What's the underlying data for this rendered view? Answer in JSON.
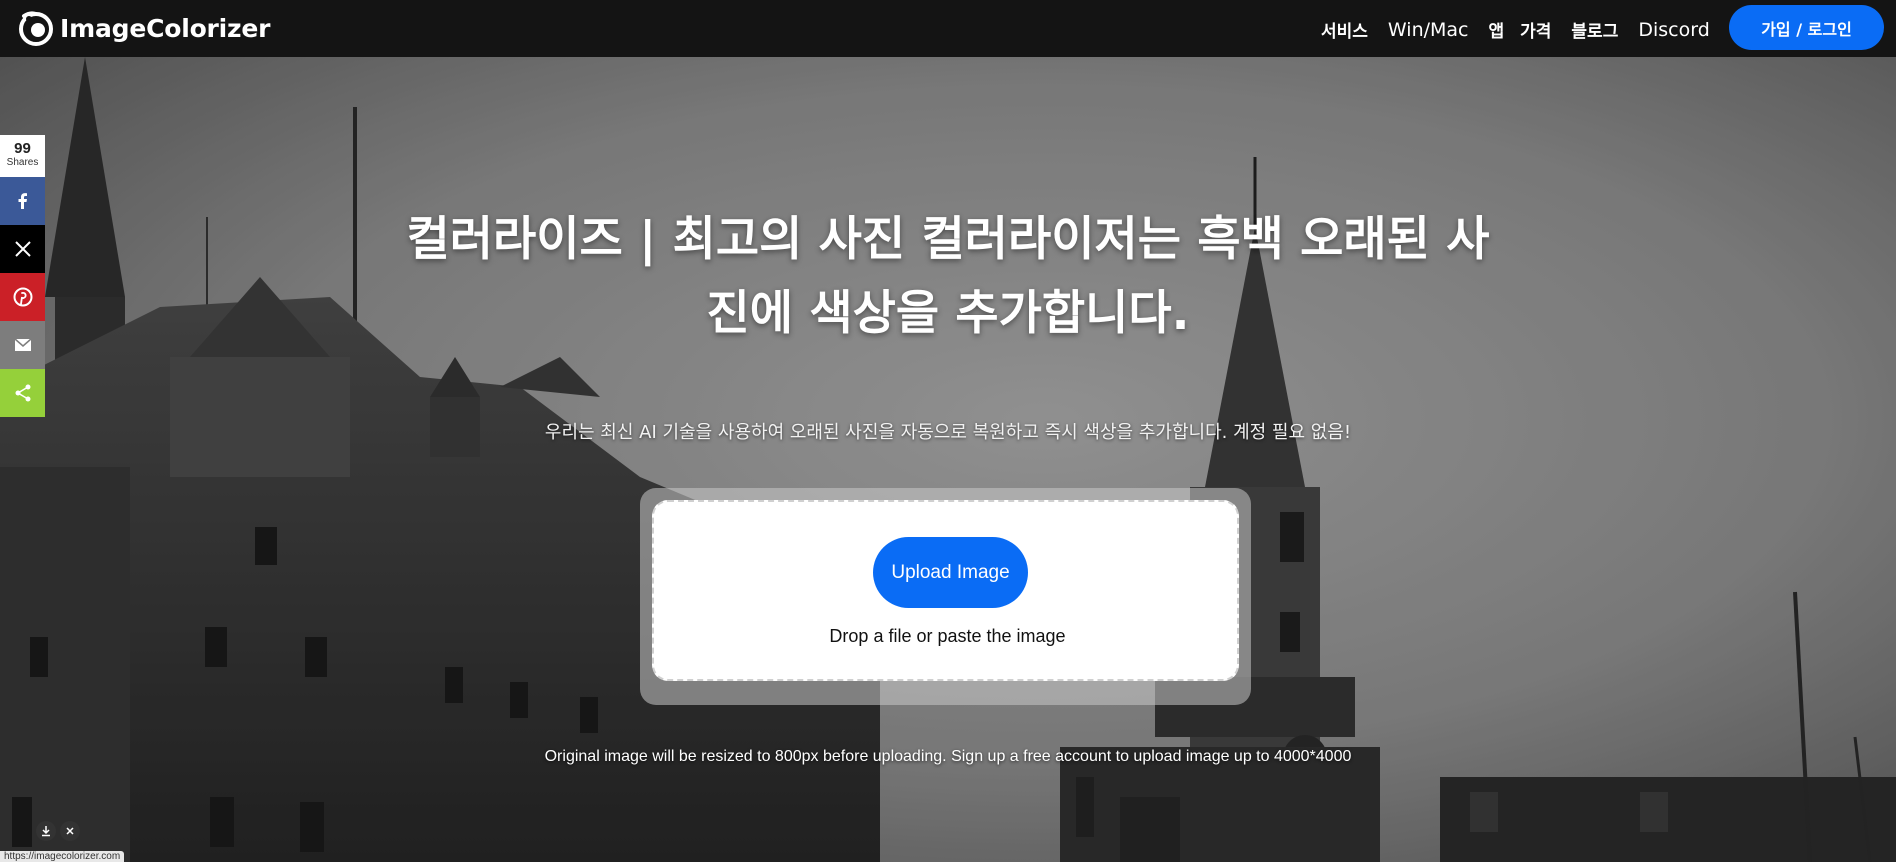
{
  "header": {
    "brand": "ImageColorizer",
    "nav": [
      "서비스",
      "Win/Mac",
      "앱",
      "가격",
      "블로그",
      "Discord"
    ],
    "login_label": "가입 / 로그인"
  },
  "hero": {
    "title": "컬러라이즈 | 최고의 사진 컬러라이저는 흑백 오래된 사진에 색상을 추가합니다.",
    "subtitle": "우리는 최신 AI 기술을 사용하여 오래된 사진을 자동으로 복원하고 즉시 색상을 추가합니다. 계정 필요 없음!",
    "upload_label": "Upload Image",
    "drop_text": "Drop a file or paste the image",
    "note": "Original image will be resized to 800px before uploading. Sign up a free account to upload image up to 4000*4000"
  },
  "share": {
    "count": "99",
    "count_label": "Shares",
    "buttons": [
      {
        "icon": "facebook-icon",
        "color": "#3b5998"
      },
      {
        "icon": "x-icon",
        "color": "#000000"
      },
      {
        "icon": "pinterest-icon",
        "color": "#cb2027"
      },
      {
        "icon": "email-icon",
        "color": "#7d7d7d"
      },
      {
        "icon": "share-icon",
        "color": "#95d03a"
      }
    ]
  },
  "status_url": "https://imagecolorizer.com",
  "colors": {
    "accent": "#0a6cf5",
    "header_bg": "#141414"
  }
}
